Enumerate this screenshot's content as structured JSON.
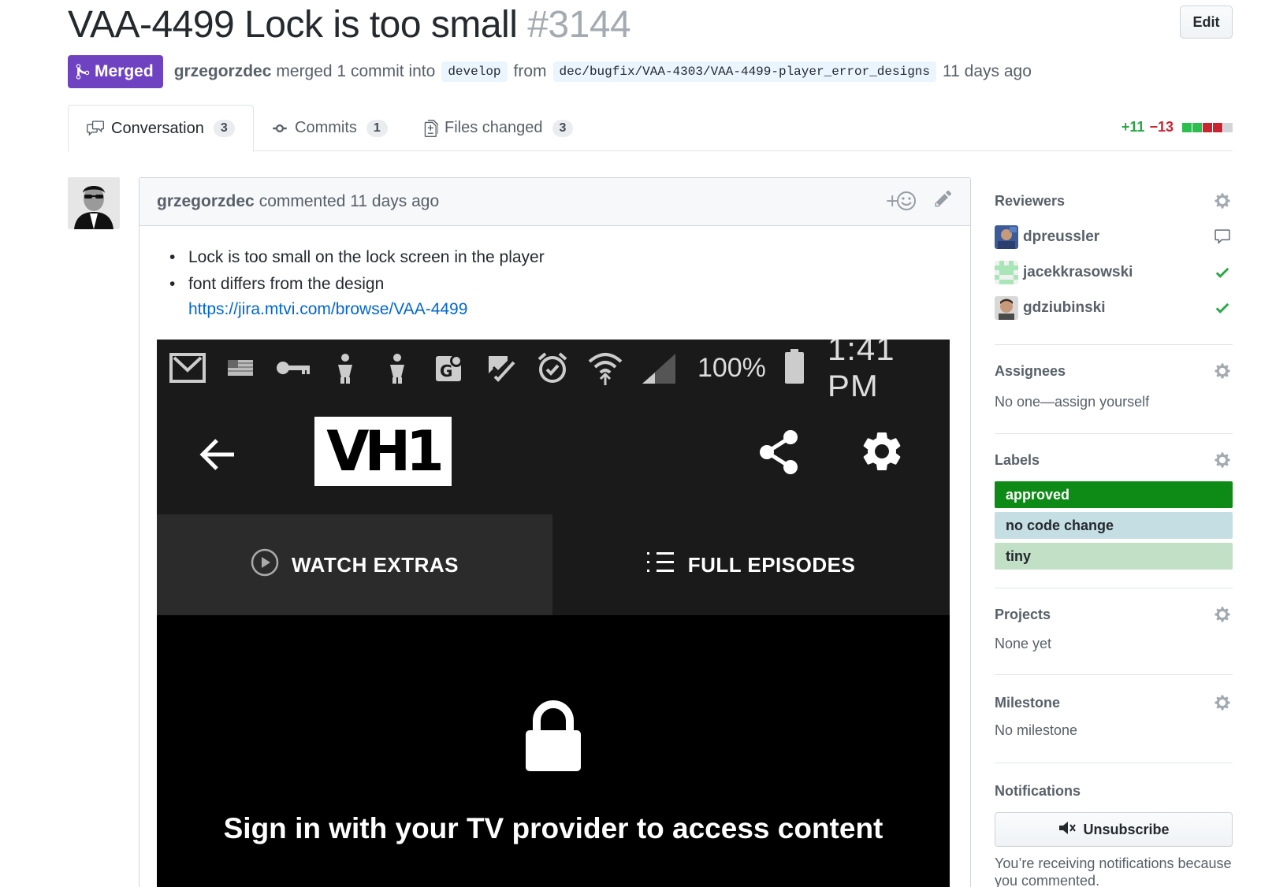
{
  "pr": {
    "title": "VAA-4499 Lock is too small",
    "number": "#3144",
    "edit_label": "Edit",
    "state": "Merged",
    "author": "grzegorzdec",
    "merged_text": "merged 1 commit into",
    "base_branch": "develop",
    "from_text": "from",
    "head_branch": "dec/bugfix/VAA-4303/VAA-4499-player_error_designs",
    "time": "11 days ago"
  },
  "tabs": [
    {
      "label": "Conversation",
      "count": "3"
    },
    {
      "label": "Commits",
      "count": "1"
    },
    {
      "label": "Files changed",
      "count": "3"
    }
  ],
  "diffstat": {
    "additions": "+11",
    "deletions": "−13"
  },
  "comment": {
    "author": "grzegorzdec",
    "meta": "commented 11 days ago",
    "bullets": [
      "Lock is too small on the lock screen in the player",
      "font differs from the design"
    ],
    "link": "https://jira.mtvi.com/browse/VAA-4499"
  },
  "screenshot": {
    "battery": "100%",
    "time": "1:41 PM",
    "logo": "VH1",
    "tab_left": "WATCH EXTRAS",
    "tab_right": "FULL EPISODES",
    "message": "Sign in with your TV provider to access content"
  },
  "sidebar": {
    "reviewers_title": "Reviewers",
    "reviewers": [
      {
        "name": "dpreussler",
        "status": "comment-icon"
      },
      {
        "name": "jacekkrasowski",
        "status": "check-icon"
      },
      {
        "name": "gdziubinski",
        "status": "check-icon"
      }
    ],
    "assignees_title": "Assignees",
    "assignees_text": "No one—assign yourself",
    "labels_title": "Labels",
    "labels": [
      {
        "name": "approved",
        "color": "#0e8a16",
        "text_color": "#ffffff"
      },
      {
        "name": "no code change",
        "color": "#c5dee3",
        "text_color": "#24292e"
      },
      {
        "name": "tiny",
        "color": "#c2e0c6",
        "text_color": "#24292e"
      }
    ],
    "projects_title": "Projects",
    "projects_text": "None yet",
    "milestone_title": "Milestone",
    "milestone_text": "No milestone",
    "notifications_title": "Notifications",
    "unsubscribe_label": "Unsubscribe",
    "notifications_text": "You’re receiving notifications because you commented."
  }
}
